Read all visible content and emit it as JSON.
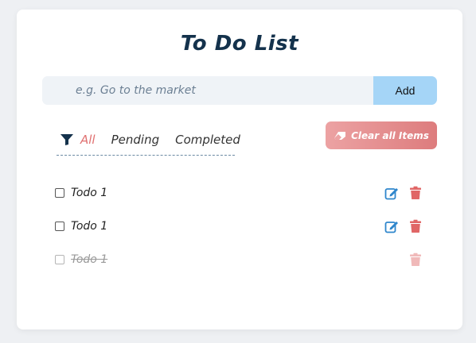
{
  "app": {
    "title": "To Do List"
  },
  "input": {
    "placeholder": "e.g. Go to the market",
    "value": "",
    "add_label": "Add"
  },
  "filters": {
    "icon": "filter-icon",
    "tabs": [
      "All",
      "Pending",
      "Completed"
    ],
    "active": "All"
  },
  "clear_button": {
    "label": "Clear all Items",
    "icon": "eraser-icon"
  },
  "todos": [
    {
      "label": "Todo 1",
      "completed": false
    },
    {
      "label": "Todo 1",
      "completed": false
    },
    {
      "label": "Todo 1",
      "completed": true
    }
  ],
  "colors": {
    "title": "#14324c",
    "accent_active": "#e07070",
    "edit_icon": "#2f86cc",
    "delete_icon": "#e06666",
    "add_button": "#a5d5f7",
    "clear_gradient_start": "#eca2a3",
    "clear_gradient_end": "#dd7c7d"
  }
}
